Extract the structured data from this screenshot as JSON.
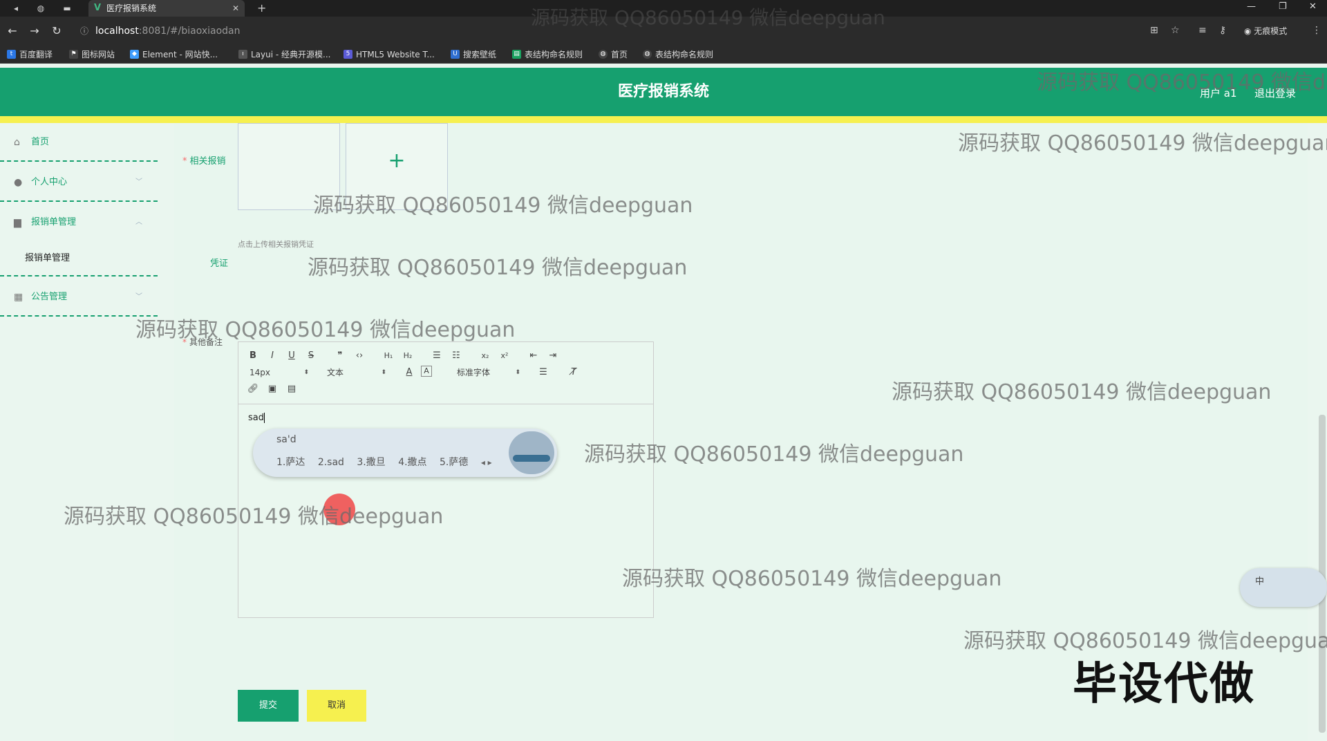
{
  "browser": {
    "tab_title": "医疗报销系统",
    "url_host": "localhost",
    "url_path": ":8081/#/biaoxiaodan",
    "profile_label": "无痕模式",
    "bookmarks": [
      "百度翻译",
      "图标网站",
      "Element - 网站快...",
      "Layui - 经典开源模...",
      "HTML5 Website T...",
      "搜索壁纸",
      "表结构命名规则",
      "首页",
      "表结构命名规则"
    ]
  },
  "header": {
    "title": "医疗报销系统",
    "user_label": "用户 a1",
    "logout_label": "退出登录",
    "colors": {
      "primary": "#16a06f",
      "stripe": "#f6f04f"
    }
  },
  "sidebar": {
    "items": [
      {
        "label": "首页",
        "icon": "home-icon"
      },
      {
        "label": "个人中心",
        "icon": "user-icon"
      },
      {
        "label": "报销单管理",
        "icon": "briefcase-icon"
      },
      {
        "label": "报销单管理",
        "icon": ""
      },
      {
        "label": "公告管理",
        "icon": "grid-icon"
      }
    ]
  },
  "form": {
    "related_receipt_label": "相关报销",
    "voucher_label": "凭证",
    "upload_tip": "点击上传相关报销凭证",
    "remark_label": "其他备注",
    "submit_label": "提交",
    "cancel_label": "取消"
  },
  "editor": {
    "font_size": "14px",
    "block_format": "文本",
    "font_family": "标准字体",
    "content": "sad"
  },
  "ime": {
    "composition": "sa'd",
    "candidates": [
      "1.萨达",
      "2.sad",
      "3.撒旦",
      "4.撒点",
      "5.萨德"
    ],
    "mode": "中"
  },
  "watermarks": {
    "text": "源码获取 QQ86050149 微信deepguan",
    "stamp": "毕设代做"
  }
}
